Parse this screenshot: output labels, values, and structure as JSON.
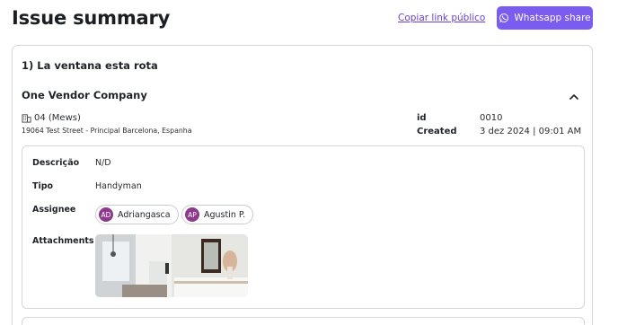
{
  "header": {
    "title": "Issue summary",
    "copy_link_label": "Copiar link público",
    "whatsapp_label": "Whatsapp share"
  },
  "issue": {
    "title": "1) La ventana esta rota",
    "vendor": "One Vendor Company",
    "unit": "04 (Mews)",
    "address": "19064 Test Street - Principal Barcelona, Espanha",
    "id_label": "id",
    "id_value": "0010",
    "created_label": "Created",
    "created_value": "3 dez 2024 | 09:01 AM",
    "details": {
      "descricao_label": "Descrição",
      "descricao_value": "N/D",
      "tipo_label": "Tipo",
      "tipo_value": "Handyman",
      "assignee_label": "Assignee",
      "assignees": [
        {
          "initials": "AD",
          "name": "Adriangasca"
        },
        {
          "initials": "AP",
          "name": "Agustin P."
        }
      ],
      "attachments_label": "Attachments"
    }
  },
  "colors": {
    "accent": "#7b5cf0",
    "link": "#6b3fd6",
    "avatar": "#8e3a8c",
    "border": "#d4d6da"
  },
  "icons": [
    "whatsapp-icon",
    "chevron-up-icon",
    "building-icon"
  ]
}
